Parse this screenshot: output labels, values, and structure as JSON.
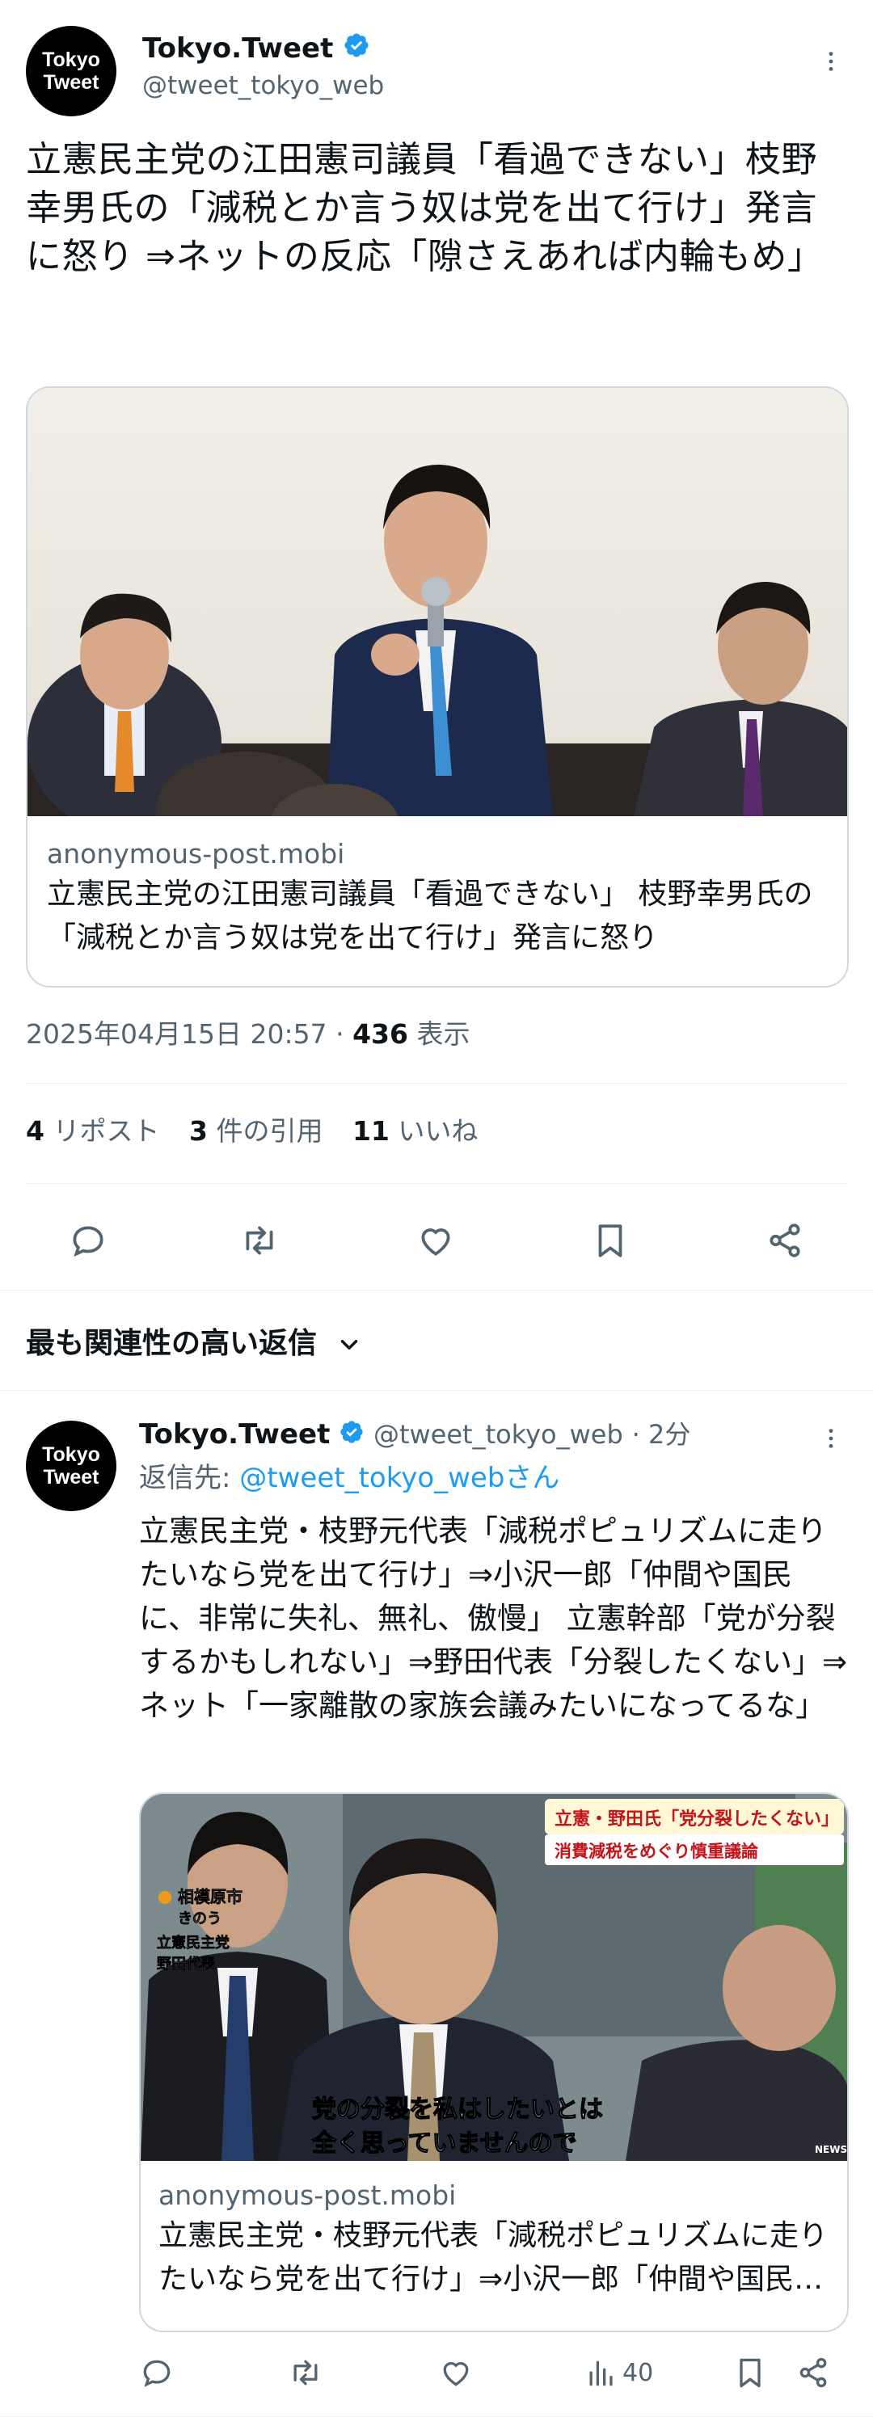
{
  "main_tweet": {
    "avatar_line1": "Tokyo",
    "avatar_line2": "Tweet",
    "display_name": "Tokyo.Tweet",
    "handle": "@tweet_tokyo_web",
    "text": "立憲民主党の江田憲司議員「看過できない」枝野幸男氏の「減税とか言う奴は党を出て行け」発言に怒り ⇒ネットの反応「隙さえあれば内輪もめ」",
    "card": {
      "domain": "anonymous-post.mobi",
      "title": "立憲民主党の江田憲司議員「看過できない」 枝野幸男氏の「減税とか言う奴は党を出て行け」発言に怒り"
    },
    "timestamp": "2025年04月15日 20:57",
    "sep": "·",
    "views_count": "436",
    "views_label": "表示",
    "reposts_count": "4",
    "reposts_label": "リポスト",
    "quotes_count": "3",
    "quotes_label": "件の引用",
    "likes_count": "11",
    "likes_label": "いいね"
  },
  "replies_sort_label": "最も関連性の高い返信",
  "reply": {
    "display_name": "Tokyo.Tweet",
    "handle": "@tweet_tokyo_web",
    "time": "· 2分",
    "reply_to_prefix": "返信先:",
    "reply_to_handle": "@tweet_tokyo_webさん",
    "text": "立憲民主党・枝野元代表「減税ポピュリズムに走りたいなら党を出て行け」⇒小沢一郎「仲間や国民に、非常に失礼、無礼、傲慢」 立憲幹部「党が分裂するかもしれない」⇒野田代表「分裂したくない」⇒ネット「一家離散の家族会議みたいになってるな」",
    "image_texts": {
      "banner_top": "立憲・野田氏「党分裂したくない」",
      "banner_bottom": "消費減税をめぐり慎重議論",
      "location": "相模原市",
      "date": "きのう",
      "party": "立憲民主党",
      "person": "野田代表",
      "caption1": "党の分裂を私はしたいとは",
      "caption2": "全く思っていませんので",
      "news": "NEWS"
    },
    "card": {
      "domain": "anonymous-post.mobi",
      "title": "立憲民主党・枝野元代表「減税ポピュリズムに走りたいなら党を出て行け」⇒小沢一郎「仲間や国民に、非常に失礼、無礼、傲慢」"
    },
    "views": "40"
  },
  "colors": {
    "accent": "#1d9bf0",
    "text": "#0f1419",
    "secondary": "#536471",
    "border": "#cfd9de"
  },
  "icons": [
    "more-icon",
    "verified-icon",
    "reply-icon",
    "retweet-icon",
    "like-icon",
    "bookmark-icon",
    "share-icon",
    "chevron-down-icon",
    "views-icon"
  ]
}
